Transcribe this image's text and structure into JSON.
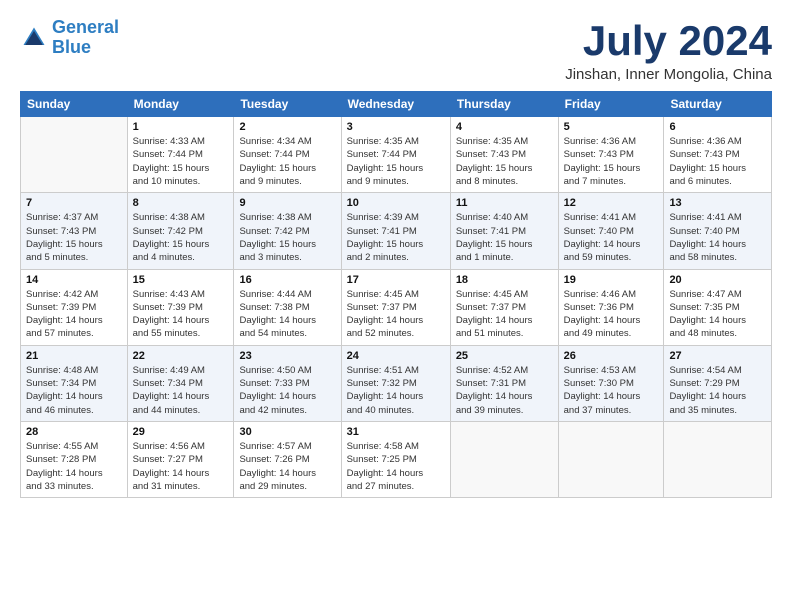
{
  "logo": {
    "line1": "General",
    "line2": "Blue"
  },
  "title": "July 2024",
  "location": "Jinshan, Inner Mongolia, China",
  "weekdays": [
    "Sunday",
    "Monday",
    "Tuesday",
    "Wednesday",
    "Thursday",
    "Friday",
    "Saturday"
  ],
  "weeks": [
    [
      {
        "day": "",
        "info": ""
      },
      {
        "day": "1",
        "info": "Sunrise: 4:33 AM\nSunset: 7:44 PM\nDaylight: 15 hours\nand 10 minutes."
      },
      {
        "day": "2",
        "info": "Sunrise: 4:34 AM\nSunset: 7:44 PM\nDaylight: 15 hours\nand 9 minutes."
      },
      {
        "day": "3",
        "info": "Sunrise: 4:35 AM\nSunset: 7:44 PM\nDaylight: 15 hours\nand 9 minutes."
      },
      {
        "day": "4",
        "info": "Sunrise: 4:35 AM\nSunset: 7:43 PM\nDaylight: 15 hours\nand 8 minutes."
      },
      {
        "day": "5",
        "info": "Sunrise: 4:36 AM\nSunset: 7:43 PM\nDaylight: 15 hours\nand 7 minutes."
      },
      {
        "day": "6",
        "info": "Sunrise: 4:36 AM\nSunset: 7:43 PM\nDaylight: 15 hours\nand 6 minutes."
      }
    ],
    [
      {
        "day": "7",
        "info": "Sunrise: 4:37 AM\nSunset: 7:43 PM\nDaylight: 15 hours\nand 5 minutes."
      },
      {
        "day": "8",
        "info": "Sunrise: 4:38 AM\nSunset: 7:42 PM\nDaylight: 15 hours\nand 4 minutes."
      },
      {
        "day": "9",
        "info": "Sunrise: 4:38 AM\nSunset: 7:42 PM\nDaylight: 15 hours\nand 3 minutes."
      },
      {
        "day": "10",
        "info": "Sunrise: 4:39 AM\nSunset: 7:41 PM\nDaylight: 15 hours\nand 2 minutes."
      },
      {
        "day": "11",
        "info": "Sunrise: 4:40 AM\nSunset: 7:41 PM\nDaylight: 15 hours\nand 1 minute."
      },
      {
        "day": "12",
        "info": "Sunrise: 4:41 AM\nSunset: 7:40 PM\nDaylight: 14 hours\nand 59 minutes."
      },
      {
        "day": "13",
        "info": "Sunrise: 4:41 AM\nSunset: 7:40 PM\nDaylight: 14 hours\nand 58 minutes."
      }
    ],
    [
      {
        "day": "14",
        "info": "Sunrise: 4:42 AM\nSunset: 7:39 PM\nDaylight: 14 hours\nand 57 minutes."
      },
      {
        "day": "15",
        "info": "Sunrise: 4:43 AM\nSunset: 7:39 PM\nDaylight: 14 hours\nand 55 minutes."
      },
      {
        "day": "16",
        "info": "Sunrise: 4:44 AM\nSunset: 7:38 PM\nDaylight: 14 hours\nand 54 minutes."
      },
      {
        "day": "17",
        "info": "Sunrise: 4:45 AM\nSunset: 7:37 PM\nDaylight: 14 hours\nand 52 minutes."
      },
      {
        "day": "18",
        "info": "Sunrise: 4:45 AM\nSunset: 7:37 PM\nDaylight: 14 hours\nand 51 minutes."
      },
      {
        "day": "19",
        "info": "Sunrise: 4:46 AM\nSunset: 7:36 PM\nDaylight: 14 hours\nand 49 minutes."
      },
      {
        "day": "20",
        "info": "Sunrise: 4:47 AM\nSunset: 7:35 PM\nDaylight: 14 hours\nand 48 minutes."
      }
    ],
    [
      {
        "day": "21",
        "info": "Sunrise: 4:48 AM\nSunset: 7:34 PM\nDaylight: 14 hours\nand 46 minutes."
      },
      {
        "day": "22",
        "info": "Sunrise: 4:49 AM\nSunset: 7:34 PM\nDaylight: 14 hours\nand 44 minutes."
      },
      {
        "day": "23",
        "info": "Sunrise: 4:50 AM\nSunset: 7:33 PM\nDaylight: 14 hours\nand 42 minutes."
      },
      {
        "day": "24",
        "info": "Sunrise: 4:51 AM\nSunset: 7:32 PM\nDaylight: 14 hours\nand 40 minutes."
      },
      {
        "day": "25",
        "info": "Sunrise: 4:52 AM\nSunset: 7:31 PM\nDaylight: 14 hours\nand 39 minutes."
      },
      {
        "day": "26",
        "info": "Sunrise: 4:53 AM\nSunset: 7:30 PM\nDaylight: 14 hours\nand 37 minutes."
      },
      {
        "day": "27",
        "info": "Sunrise: 4:54 AM\nSunset: 7:29 PM\nDaylight: 14 hours\nand 35 minutes."
      }
    ],
    [
      {
        "day": "28",
        "info": "Sunrise: 4:55 AM\nSunset: 7:28 PM\nDaylight: 14 hours\nand 33 minutes."
      },
      {
        "day": "29",
        "info": "Sunrise: 4:56 AM\nSunset: 7:27 PM\nDaylight: 14 hours\nand 31 minutes."
      },
      {
        "day": "30",
        "info": "Sunrise: 4:57 AM\nSunset: 7:26 PM\nDaylight: 14 hours\nand 29 minutes."
      },
      {
        "day": "31",
        "info": "Sunrise: 4:58 AM\nSunset: 7:25 PM\nDaylight: 14 hours\nand 27 minutes."
      },
      {
        "day": "",
        "info": ""
      },
      {
        "day": "",
        "info": ""
      },
      {
        "day": "",
        "info": ""
      }
    ]
  ]
}
